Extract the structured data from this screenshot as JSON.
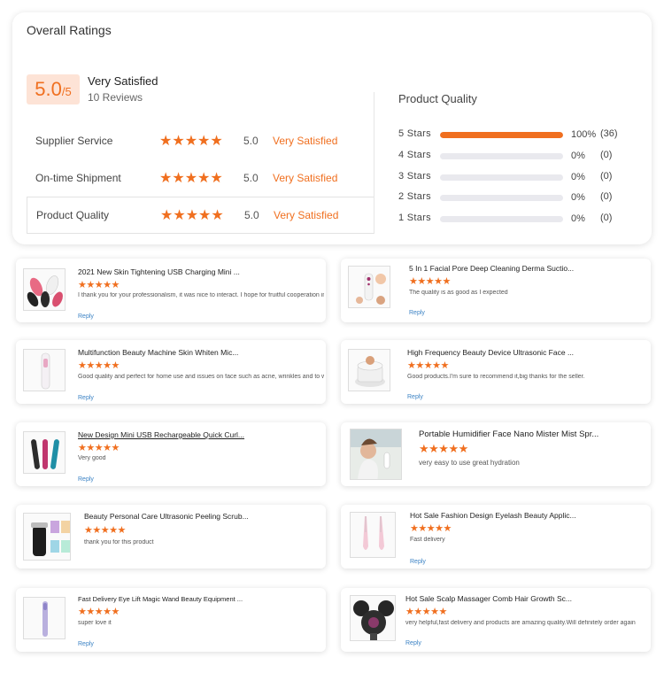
{
  "overall": {
    "title": "Overall Ratings",
    "score": "5.0",
    "score_denom": "/5",
    "summary_label": "Very Satisfied",
    "review_count": "10 Reviews",
    "rows": [
      {
        "label": "Supplier Service",
        "stars": "★★★★★",
        "score": "5.0",
        "desc": "Very Satisfied"
      },
      {
        "label": "On-time Shipment",
        "stars": "★★★★★",
        "score": "5.0",
        "desc": "Very Satisfied"
      },
      {
        "label": "Product Quality",
        "stars": "★★★★★",
        "score": "5.0",
        "desc": "Very Satisfied"
      }
    ]
  },
  "product_quality": {
    "title": "Product Quality",
    "bars": [
      {
        "label": "5 Stars",
        "percent": "100%",
        "count": "(36)",
        "fill": 1.0
      },
      {
        "label": "4 Stars",
        "percent": "0%",
        "count": "(0)",
        "fill": 0
      },
      {
        "label": "3 Stars",
        "percent": "0%",
        "count": "(0)",
        "fill": 0
      },
      {
        "label": "2 Stars",
        "percent": "0%",
        "count": "(0)",
        "fill": 0
      },
      {
        "label": "1 Stars",
        "percent": "0%",
        "count": "(0)",
        "fill": 0
      }
    ]
  },
  "colors": {
    "accent": "#f06f1f",
    "score_bg": "#fde3d6",
    "link": "#3b82c4"
  },
  "reviews": [
    {
      "title": "2021 New Skin Tightening USB Charging Mini ...",
      "stars": "★★★★★",
      "text": "I thank you for your professionalism, it was nice to interact. I hope for fruitful cooperation in t",
      "reply": "Reply",
      "thumb": "pink-black-devices"
    },
    {
      "title": "5 In 1 Facial Pore Deep Cleaning Derma Suctio...",
      "stars": "★★★★★",
      "text": "The quality is as good as I expected",
      "reply": "Reply",
      "thumb": "pore-vacuum"
    },
    {
      "title": "Multifunction Beauty Machine Skin Whiten Mic...",
      "stars": "★★★★★",
      "text": "Good quality and perfect for home use and issues on face  such as acne, wrinkles and to whi",
      "reply": "Reply",
      "thumb": "beauty-wand"
    },
    {
      "title": "High Frequency Beauty Device Ultrasonic Face ...",
      "stars": "★★★★★",
      "text": "Good products.I'm sure to recommend it,big thanks for the seller.",
      "reply": "Reply",
      "thumb": "round-device"
    },
    {
      "title": "New Design Mini USB Rechargeable Quick Curl...",
      "stars": "★★★★★",
      "text": "Very good",
      "reply": "Reply",
      "thumb": "eyelash-curlers"
    },
    {
      "title": "Portable Humidifier Face Nano Mister Mist Spr...",
      "stars": "★★★★★",
      "text": "very easy to use great hydration",
      "reply": "Reply",
      "thumb": "face-mister-photo"
    },
    {
      "title": "Beauty Personal Care Ultrasonic Peeling Scrub...",
      "stars": "★★★★★",
      "text": "thank you for this product",
      "reply": "Reply",
      "thumb": "skin-scrubber"
    },
    {
      "title": "Hot Sale Fashion Design Eyelash Beauty Applic...",
      "stars": "★★★★★",
      "text": "Fast delivery",
      "reply": "Reply",
      "thumb": "eyelash-applicator"
    },
    {
      "title": "Fast Delivery Eye Lift Magic Wand Beauty Equipment ...",
      "stars": "★★★★★",
      "text": "super love it",
      "reply": "Reply",
      "thumb": "eye-wand"
    },
    {
      "title": "Hot Sale Scalp Massager Comb Hair Growth Sc...",
      "stars": "★★★★★",
      "text": "very helpful,fast delivery and products are amazing quality.Will definitely order again",
      "reply": "Reply",
      "thumb": "scalp-massager"
    }
  ]
}
